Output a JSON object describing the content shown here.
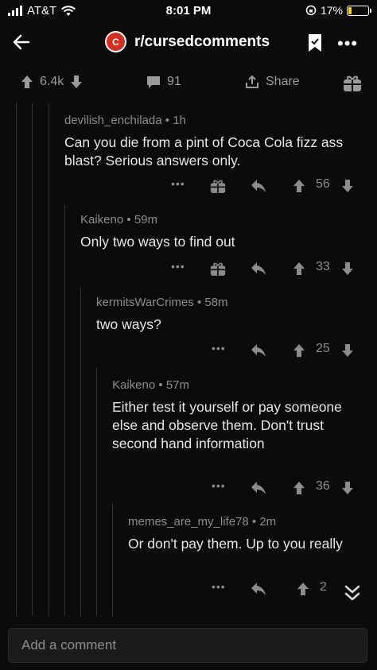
{
  "status_bar": {
    "carrier": "AT&T",
    "time": "8:01 PM",
    "battery": "17%",
    "battery_level": 0.17
  },
  "nav": {
    "title": "r/cursedcomments"
  },
  "post_actions": {
    "score": "6.4k",
    "comments": "91",
    "share_label": "Share"
  },
  "comments": [
    {
      "author": "devilish_enchilada",
      "age": "1h",
      "body": "Can you die from a pint of Coca Cola fizz ass blast? Serious answers only.",
      "score": "56"
    },
    {
      "author": "Kaikeno",
      "age": "59m",
      "body": "Only two ways to find out",
      "score": "33"
    },
    {
      "author": "kermitsWarCrimes",
      "age": "58m",
      "body": "two ways?",
      "score": "25"
    },
    {
      "author": "Kaikeno",
      "age": "57m",
      "body": "Either test it yourself or pay someone else and observe them. Don't trust second hand information",
      "score": "36"
    },
    {
      "author": "memes_are_my_life78",
      "age": "2m",
      "body": "Or don't pay them. Up to you really",
      "score": "2"
    }
  ],
  "comment_input": {
    "placeholder": "Add a comment"
  },
  "icons": {
    "upvote": "arrow-up-icon",
    "downvote": "arrow-down-icon",
    "reply": "reply-arrow-icon",
    "award": "gift-icon",
    "more": "more-dots-icon"
  }
}
